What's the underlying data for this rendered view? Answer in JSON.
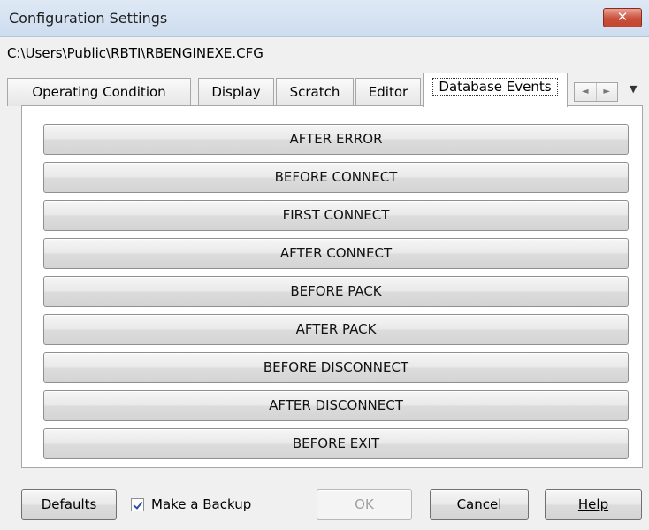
{
  "window": {
    "title": "Configuration Settings",
    "close_label": "✕"
  },
  "file_path": "C:\\Users\\Public\\RBTI\\RBENGINEXE.CFG",
  "tabs": [
    {
      "label": "Operating Condition"
    },
    {
      "label": "Display"
    },
    {
      "label": "Scratch"
    },
    {
      "label": "Editor"
    },
    {
      "label": "Database Events",
      "active": true
    }
  ],
  "tab_scroll": {
    "left": "◄",
    "right": "►",
    "menu": "▼"
  },
  "events": [
    {
      "label": "AFTER ERROR"
    },
    {
      "label": "BEFORE CONNECT"
    },
    {
      "label": "FIRST CONNECT"
    },
    {
      "label": "AFTER CONNECT"
    },
    {
      "label": "BEFORE PACK"
    },
    {
      "label": "AFTER PACK"
    },
    {
      "label": "BEFORE DISCONNECT"
    },
    {
      "label": "AFTER DISCONNECT"
    },
    {
      "label": "BEFORE EXIT"
    }
  ],
  "footer": {
    "defaults_label": "Defaults",
    "backup_label": "Make a Backup",
    "backup_checked": true,
    "ok_label": "OK",
    "cancel_label": "Cancel",
    "help_label": "Help"
  }
}
